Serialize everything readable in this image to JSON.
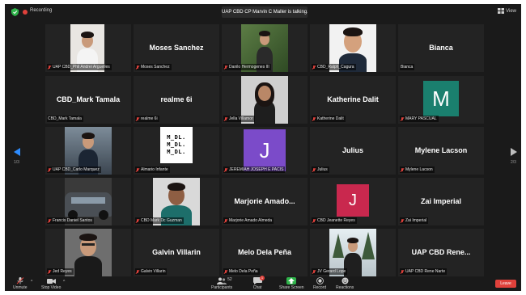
{
  "topbar": {
    "recording_label": "Recording",
    "speaker_banner": "UAP CBD CP Marvin C Maller is talking...",
    "view_label": "View"
  },
  "pager": {
    "left": "1/3",
    "right": "2/3"
  },
  "tiles": [
    {
      "label": "UAP CBD_Phil Andrei Arguelles",
      "name": ""
    },
    {
      "label": "Moses Sanchez",
      "name": "Moses Sanchez"
    },
    {
      "label": "Danilo Hermogenes III",
      "name": ""
    },
    {
      "label": "CBD_Ralph_Cagura",
      "name": ""
    },
    {
      "label": "Bianca",
      "name": "Bianca"
    },
    {
      "label": "CBD_Mark Tamala",
      "name": "CBD_Mark Tamala"
    },
    {
      "label": "realme 6i",
      "name": "realme 6i"
    },
    {
      "label": "Jella Villamor",
      "name": ""
    },
    {
      "label": "Katherine Dalit",
      "name": "Katherine Dalit"
    },
    {
      "label": "MARY PASCUAL",
      "name": "",
      "letter": "M"
    },
    {
      "label": "UAP CBD_Carlo Marquez",
      "name": ""
    },
    {
      "label": "Almario Infante",
      "name": "",
      "logo": [
        "M_DL.",
        "M_DL.",
        "M_DL."
      ]
    },
    {
      "label": "JEREMIAH JOSEPH E PACIS",
      "name": "",
      "letter": "J"
    },
    {
      "label": "Julius",
      "name": "Julius"
    },
    {
      "label": "Mylene Lacson",
      "name": "Mylene Lacson"
    },
    {
      "label": "Francis Daniel Santos",
      "name": ""
    },
    {
      "label": "CBD Mark Dc Guzman",
      "name": ""
    },
    {
      "label": "Marjorie Amado Almeda",
      "name": "Marjorie Amado..."
    },
    {
      "label": "CBD Jeanette Reyes",
      "name": "",
      "letter": "J"
    },
    {
      "label": "Zai Imperial",
      "name": "Zai Imperial"
    },
    {
      "label": "Jed Reyes",
      "name": ""
    },
    {
      "label": "Galvin Villarin",
      "name": "Galvin Villarin"
    },
    {
      "label": "Melo Dela Peña",
      "name": "Melo Dela Peña"
    },
    {
      "label": "JV Gerard Lope",
      "name": ""
    },
    {
      "label": "UAP CBD Rene Narte",
      "name": "UAP CBD Rene..."
    }
  ],
  "toolbar": {
    "unmute": "Unmute",
    "start_video": "Stop Video",
    "participants": "Participants",
    "participants_count": "52",
    "chat": "Chat",
    "chat_badge": "1",
    "share_screen": "Share Screen",
    "record": "Record",
    "reactions": "Reactions",
    "leave": "Leave"
  },
  "colors": {
    "share_green": "#2fb34a",
    "leave_red": "#e0413b",
    "arrow_blue": "#2d8cff",
    "mary_tile": "#1a7f6e",
    "jeremiah_tile": "#7b4bc9",
    "jeanette_tile": "#c9284e"
  }
}
